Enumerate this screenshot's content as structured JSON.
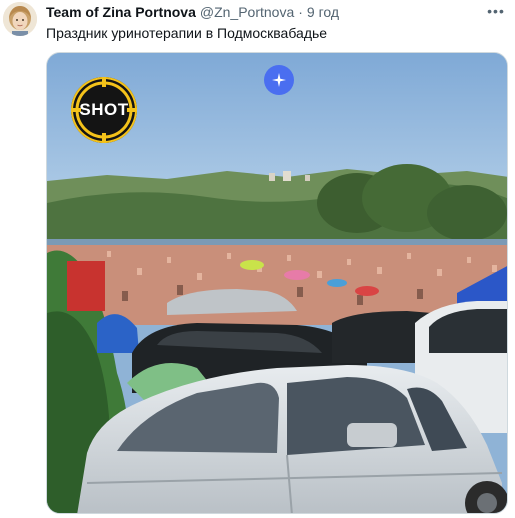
{
  "tweet": {
    "author_name": "Team of Zina Portnova",
    "handle": "@Zn_Portnova",
    "separator": "·",
    "time": "9 год",
    "more_label": "•••",
    "text": "Праздник уринотерапии в Подмосквабадье"
  },
  "media": {
    "watermark": "SHOT",
    "grok_icon": "sparkle-icon",
    "colors": {
      "sky": "#8fb6dd",
      "grok_badge": "#4a6ef0",
      "watermark_ring": "#f4c21a"
    }
  }
}
